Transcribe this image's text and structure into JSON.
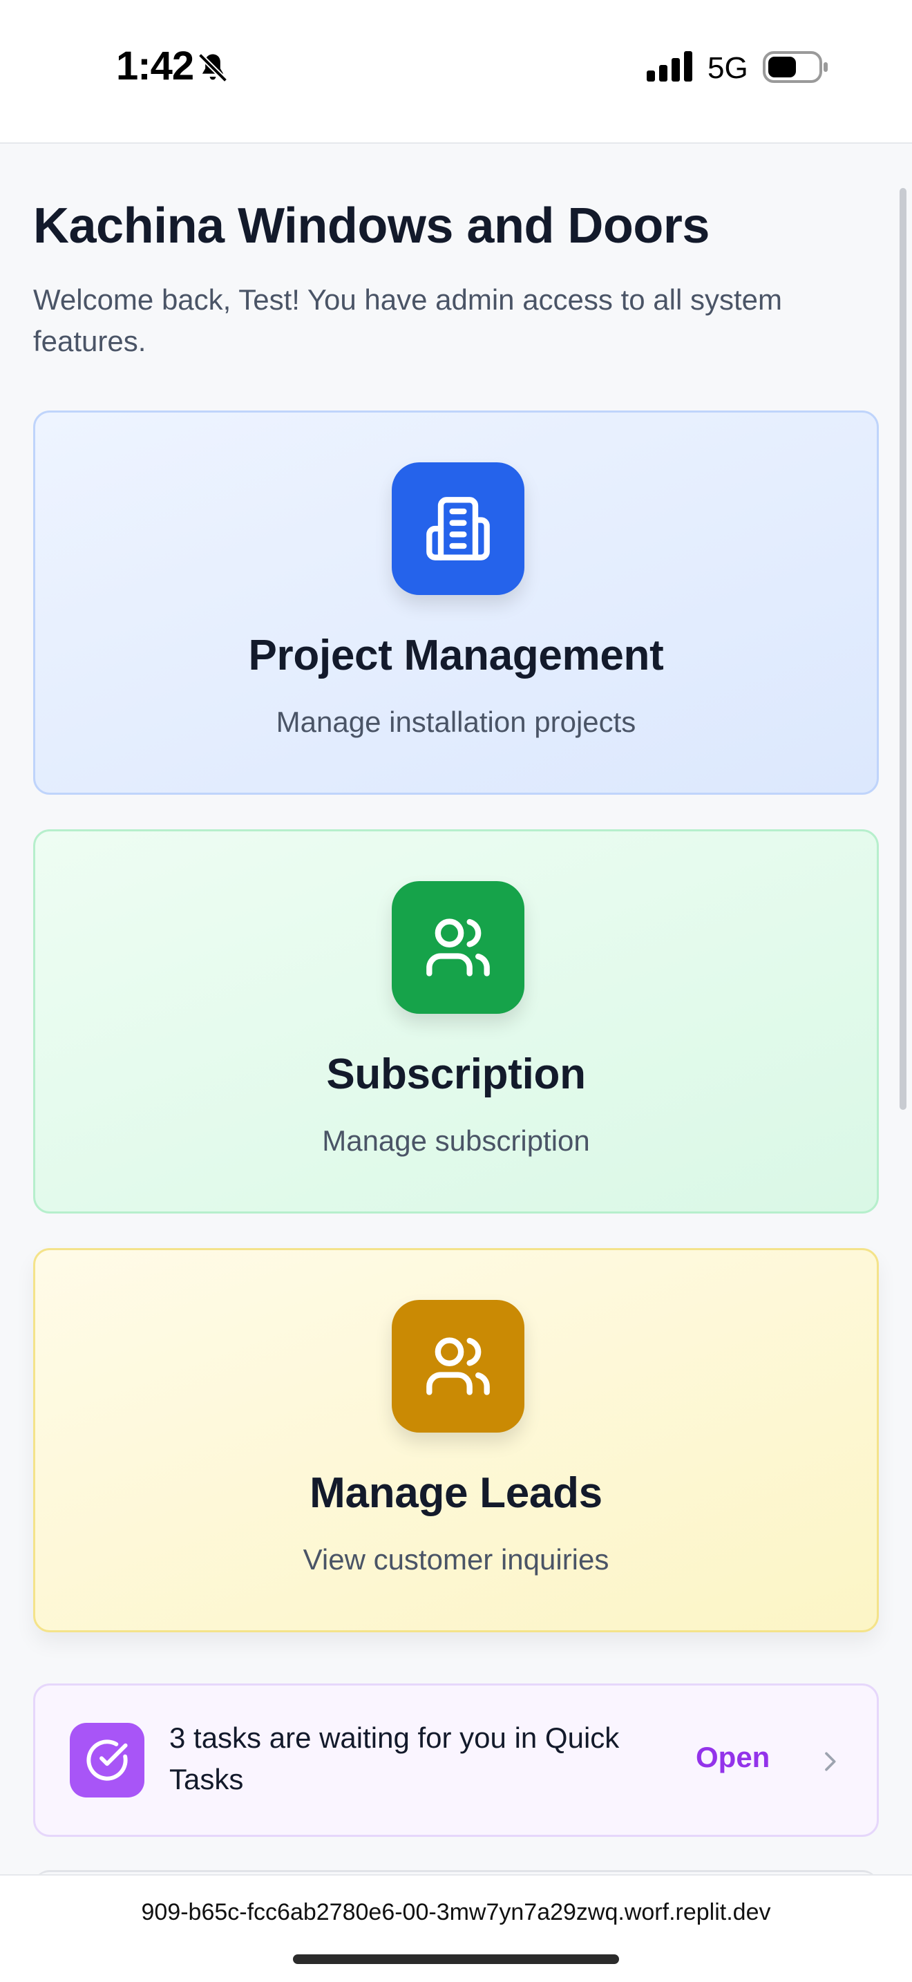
{
  "status_bar": {
    "time": "1:42",
    "network": "5G",
    "icons": [
      "bell-slash-icon",
      "signal-bars-icon",
      "battery-icon"
    ]
  },
  "header": {
    "title": "Kachina Windows and Doors",
    "subtitle": "Welcome back, Test! You have admin access to all system features."
  },
  "cards": [
    {
      "title": "Project Management",
      "description": "Manage installation projects",
      "icon": "building-icon",
      "color": "#2563eb"
    },
    {
      "title": "Subscription",
      "description": "Manage subscription",
      "icon": "users-icon",
      "color": "#16a34a"
    },
    {
      "title": "Manage Leads",
      "description": "View customer inquiries",
      "icon": "users-icon",
      "color": "#ca8a04"
    }
  ],
  "quick_tasks": {
    "message": "3 tasks are waiting for you in Quick Tasks",
    "action_label": "Open",
    "icon": "check-circle-icon",
    "accent": "#9333ea"
  },
  "browser": {
    "url": "909-b65c-fcc6ab2780e6-00-3mw7yn7a29zwq.worf.replit.dev"
  }
}
